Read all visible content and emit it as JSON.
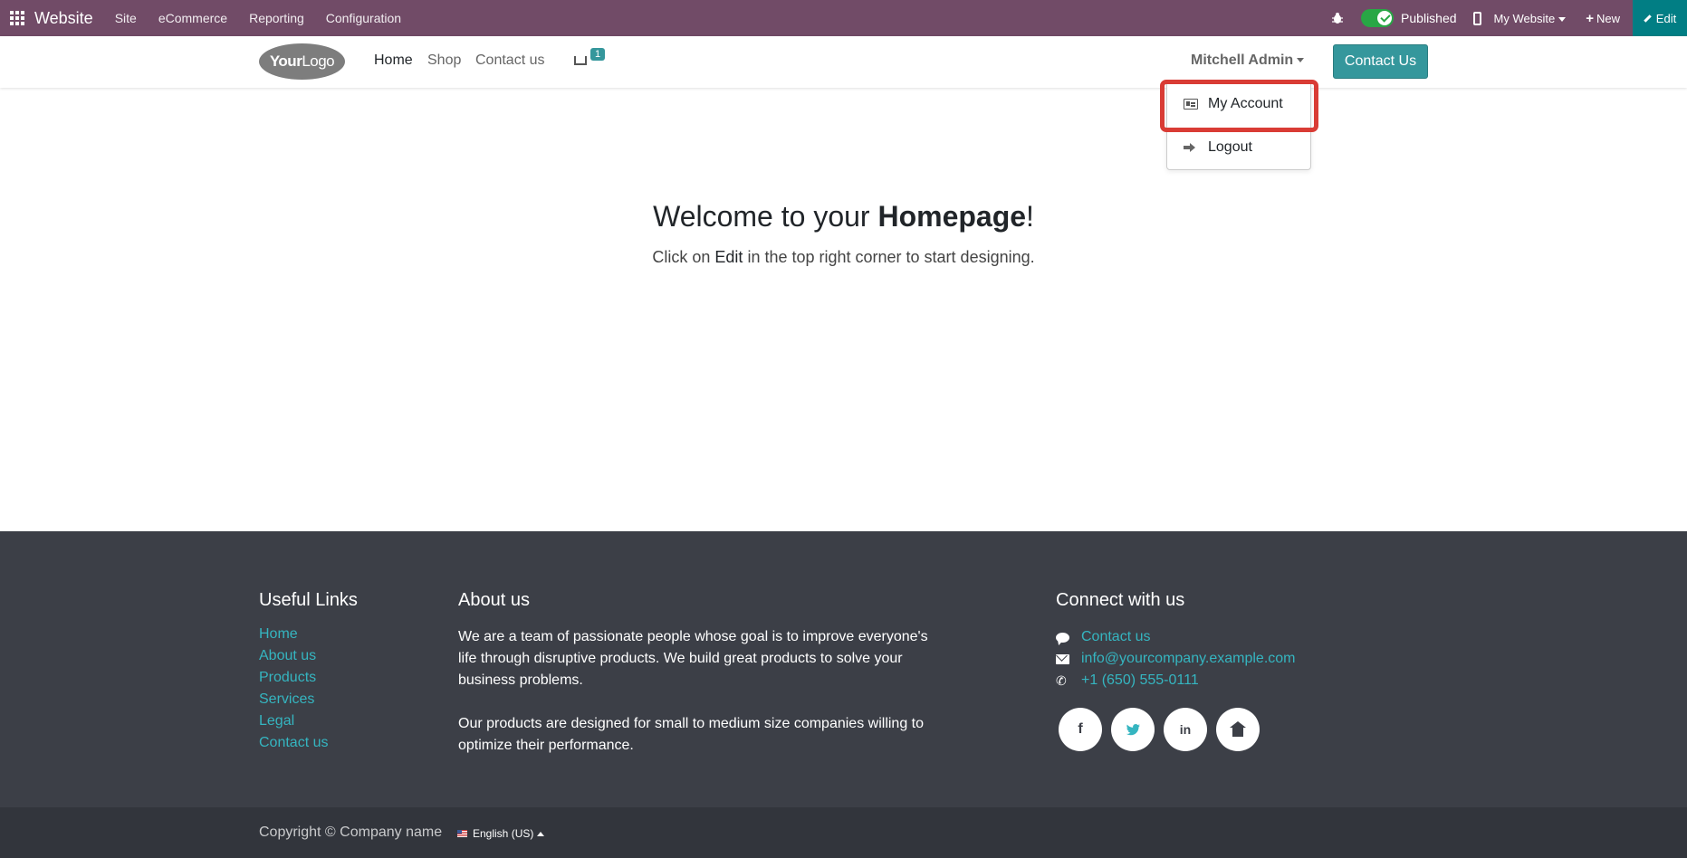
{
  "adminbar": {
    "app_name": "Website",
    "menu": [
      "Site",
      "eCommerce",
      "Reporting",
      "Configuration"
    ],
    "published_label": "Published",
    "website_select": "My Website",
    "new_label": "New",
    "edit_label": "Edit",
    "color": "#714B67"
  },
  "header": {
    "logo_bold": "Your",
    "logo_rest": "Logo",
    "nav": [
      "Home",
      "Shop",
      "Contact us"
    ],
    "cart_count": "1",
    "user_name": "Mitchell Admin",
    "contact_button": "Contact Us",
    "accent": "#35979c"
  },
  "user_dropdown": {
    "items": [
      {
        "label": "My Account",
        "icon": "id-card-icon"
      },
      {
        "label": "Logout",
        "icon": "sign-out-icon"
      }
    ],
    "highlight_color": "#d93c35"
  },
  "hero": {
    "title_pre": "Welcome to your ",
    "title_bold": "Homepage",
    "title_post": "!",
    "sub_pre": "Click on ",
    "sub_bold": "Edit",
    "sub_post": " in the top right corner to start designing."
  },
  "footer": {
    "useful_links_title": "Useful Links",
    "useful_links": [
      "Home",
      "About us",
      "Products",
      "Services",
      "Legal",
      "Contact us"
    ],
    "about_title": "About us",
    "about_p1": "We are a team of passionate people whose goal is to improve everyone's life through disruptive products. We build great products to solve your business problems.",
    "about_p2": "Our products are designed for small to medium size companies willing to optimize their performance.",
    "connect_title": "Connect with us",
    "contact": [
      {
        "icon": "comment-icon",
        "text": "Contact us"
      },
      {
        "icon": "envelope-icon",
        "text": "info@yourcompany.example.com"
      },
      {
        "icon": "phone-icon",
        "text": "+1 (650) 555-0111"
      }
    ],
    "socials": [
      "facebook-icon",
      "twitter-icon",
      "linkedin-icon",
      "home-icon"
    ],
    "link_color": "#35b5c0"
  },
  "copyright": {
    "text": "Copyright © Company name",
    "language": "English (US)"
  }
}
